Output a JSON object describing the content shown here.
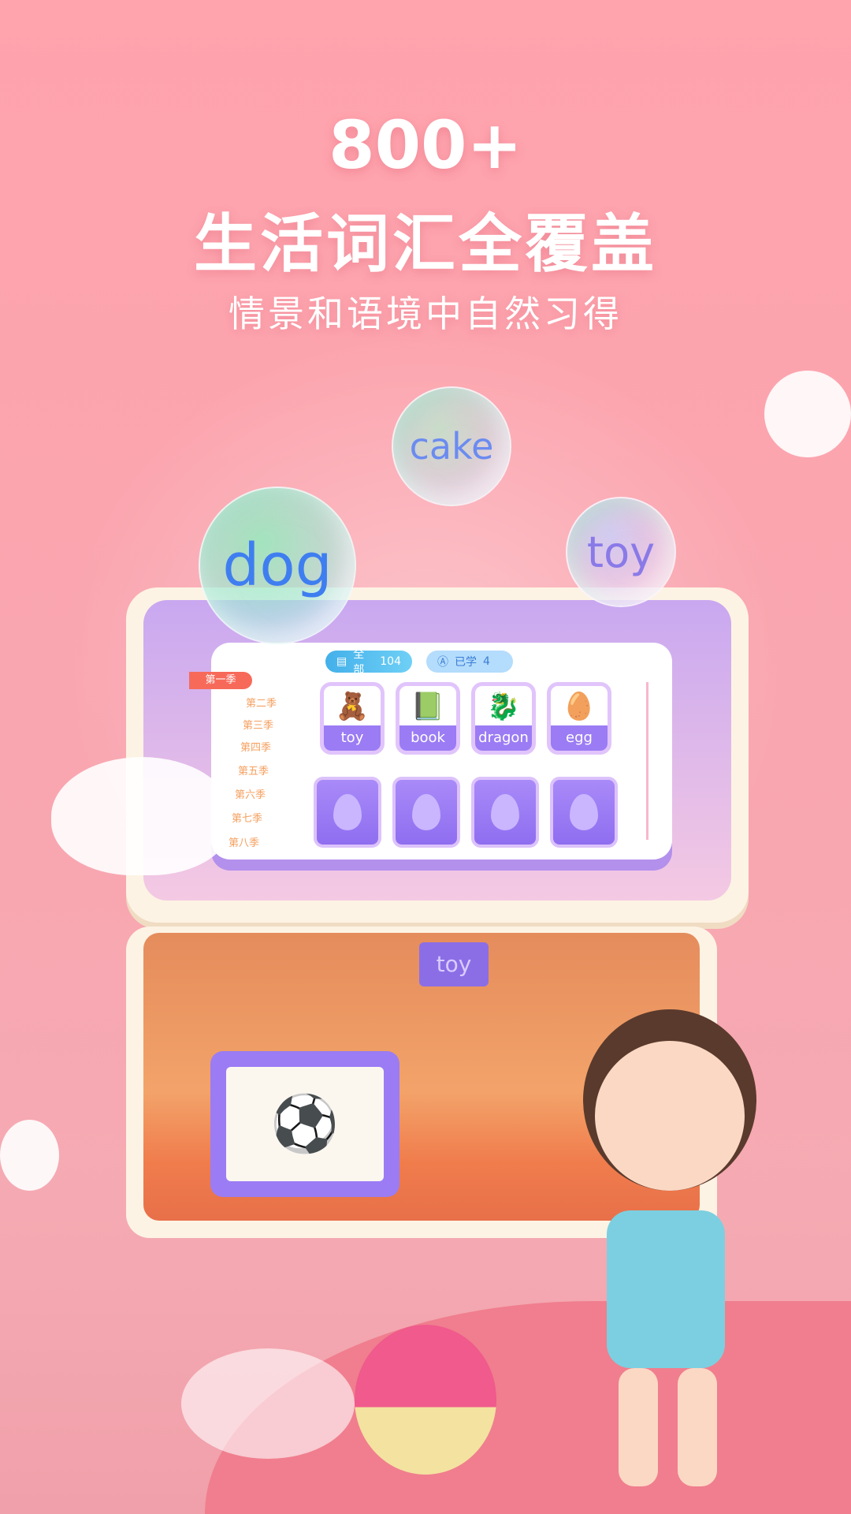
{
  "headline": {
    "count": "800+",
    "title": "生活词汇全覆盖",
    "subtitle": "情景和语境中自然习得"
  },
  "bubbles": [
    "cake",
    "dog",
    "toy"
  ],
  "app": {
    "filters": [
      {
        "icon": "list-icon",
        "label": "全部",
        "count": "104"
      },
      {
        "icon": "letter-a-icon",
        "label": "已学",
        "count": "4"
      }
    ],
    "seasons": [
      "第一季",
      "第二季",
      "第三季",
      "第四季",
      "第五季",
      "第六季",
      "第七季",
      "第八季"
    ],
    "selected_season": "第一季",
    "words": [
      {
        "word": "toy",
        "icon": "toy-blocks-icon"
      },
      {
        "word": "book",
        "icon": "book-icon"
      },
      {
        "word": "dragon",
        "icon": "dragon-icon"
      },
      {
        "word": "egg",
        "icon": "egg-icon"
      }
    ],
    "locked_cards": 4
  },
  "scene": {
    "sign": "toy"
  },
  "colors": {
    "accent": "#9b7cf4",
    "season_active": "#f76a5a",
    "season_text": "#f5a060",
    "pill_all": "#4fb8ec",
    "pill_learned": "#a9d6fb"
  }
}
